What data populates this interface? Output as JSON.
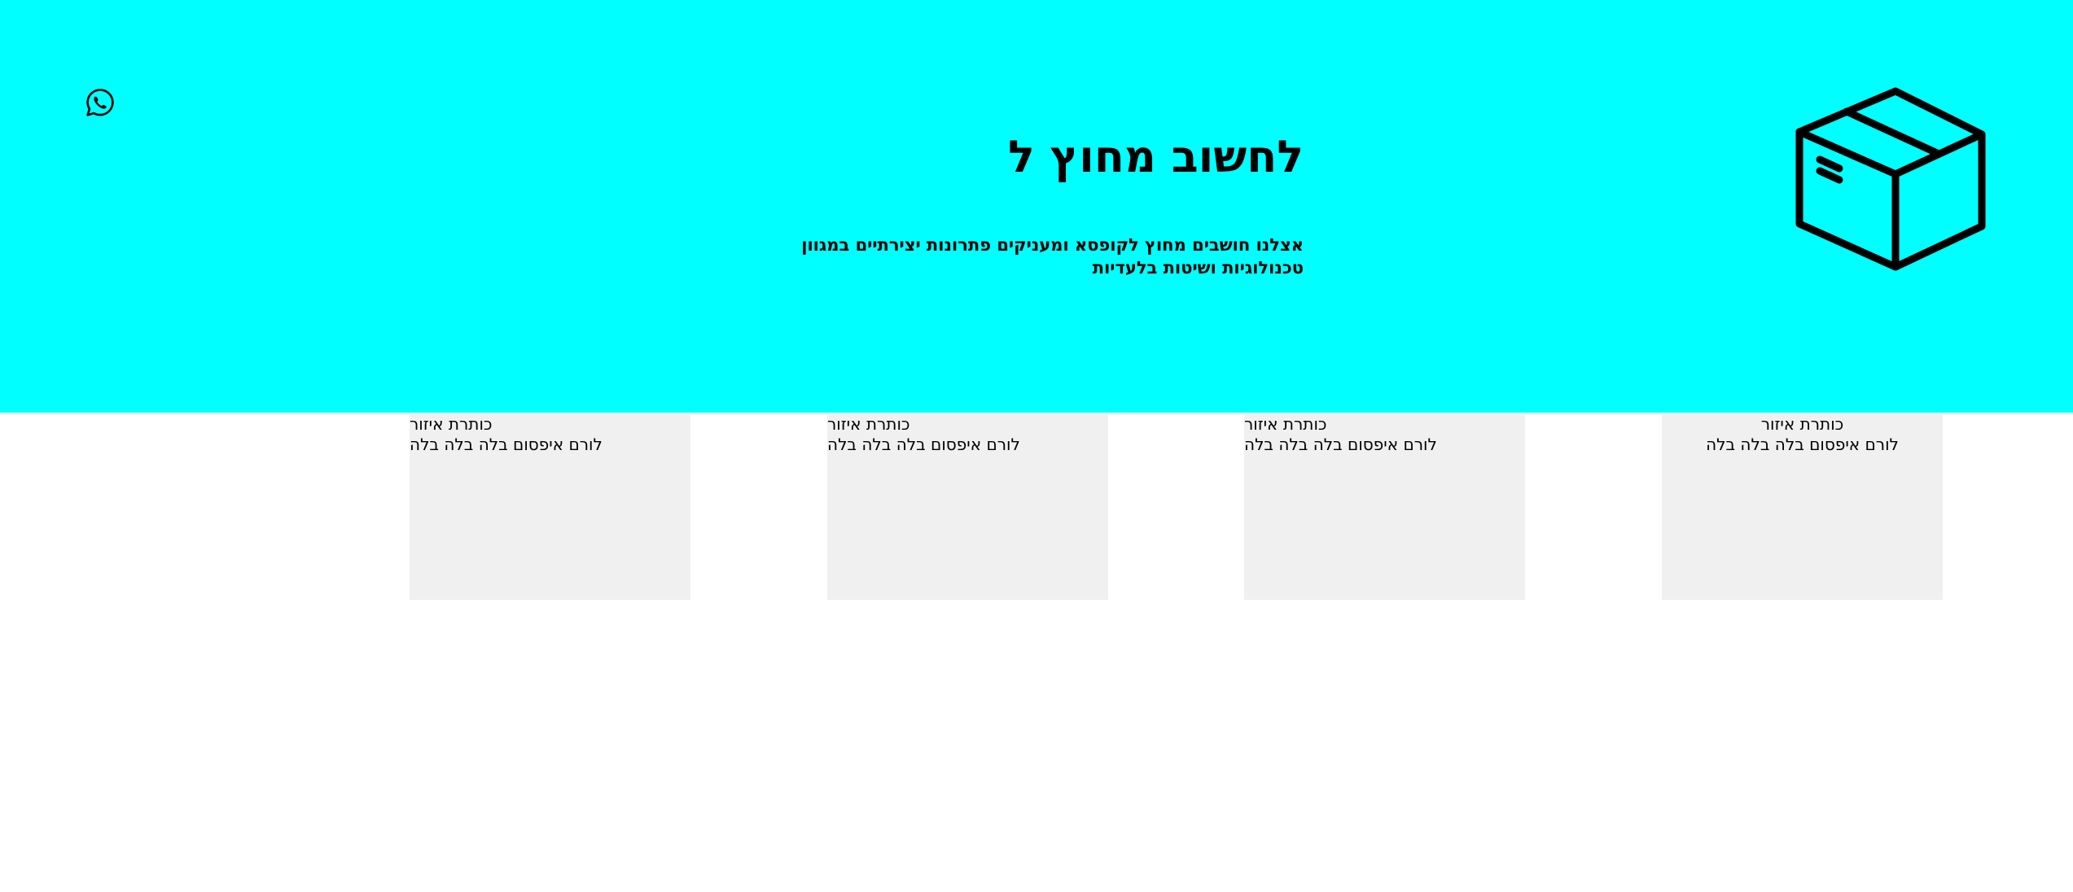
{
  "colors": {
    "hero_background": "#00ffff",
    "card_background": "#f0f0f0",
    "text": "#000000"
  },
  "header": {
    "logo_icon": "box-icon",
    "contact_icon": "whatsapp-icon"
  },
  "hero": {
    "title": "לחשוב מחוץ ל",
    "description": "אצלנו חושבים מחוץ לקופסא ומעניקים פתרונות יצירתיים במגוון טכנולוגיות ושיטות בלעדיות"
  },
  "areas": [
    {
      "title": "כותרת איזור",
      "text": "לורם איפסום בלה בלה בלה"
    },
    {
      "title": "כותרת איזור",
      "text": "לורם איפסום בלה בלה בלה"
    },
    {
      "title": "כותרת איזור",
      "text": "לורם איפסום בלה בלה בלה"
    },
    {
      "title": "כותרת איזור",
      "text": "לורם איפסום בלה בלה בלה"
    }
  ]
}
